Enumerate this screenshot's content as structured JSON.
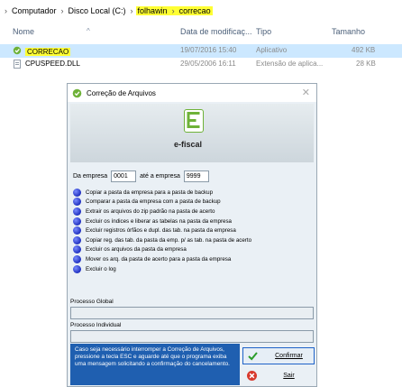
{
  "breadcrumb": {
    "items": [
      "Computador",
      "Disco Local (C:)",
      "folhawin",
      "correcao"
    ],
    "separator": "›"
  },
  "columns": {
    "name": "Nome",
    "modified": "Data de modificaç...",
    "type": "Tipo",
    "size": "Tamanho"
  },
  "files": [
    {
      "name": "CORRECAO",
      "modified": "19/07/2016 15:40",
      "type": "Aplicativo",
      "size": "492 KB"
    },
    {
      "name": "CPUSPEED.DLL",
      "modified": "29/05/2006 16:11",
      "type": "Extensão de aplica...",
      "size": "28 KB"
    }
  ],
  "dialog": {
    "title": "Correção de Arquivos",
    "close_glyph": "✕",
    "logo_text": "e-fiscal",
    "empresa_from_label": "Da empresa",
    "empresa_from_value": "0001",
    "empresa_to_label": "até a empresa",
    "empresa_to_value": "9999",
    "steps": [
      "Copiar a pasta da empresa para a pasta de backup",
      "Comparar a pasta da empresa com a pasta de backup",
      "Extrair os arquivos do zip padrão na pasta de acerto",
      "Excluir os índices e liberar as tabelas na pasta da empresa",
      "Excluir registros órfãos e dupl. das tab. na pasta da empresa",
      "Copiar reg. das tab. da pasta da emp. p/ as tab. na pasta de acerto",
      "Excluir os arquivos da pasta da empresa",
      "Mover os arq. da pasta de acerto para a pasta da empresa",
      "Excluir o log"
    ],
    "process_global_label": "Processo Global",
    "process_individual_label": "Processo Individual",
    "info_text": "Caso seja necessário interromper a Correção de Arquivos, pressione a tecla ESC e aguarde até que o programa exiba uma mensagem solicitando a confirmação do cancelamento.",
    "confirm_label": "Confirmar",
    "exit_label": "Sair"
  },
  "colors": {
    "highlight": "#ffff33",
    "info_bg": "#1f5fb0",
    "step_dot": "#2a3ad0",
    "logo_green": "#6eb238"
  },
  "icons": {
    "back": "chevron-right-icon",
    "app": "application-icon",
    "dll": "dll-file-icon",
    "dialog": "app-window-icon",
    "confirm": "checkmark-icon",
    "exit": "cancel-icon"
  }
}
